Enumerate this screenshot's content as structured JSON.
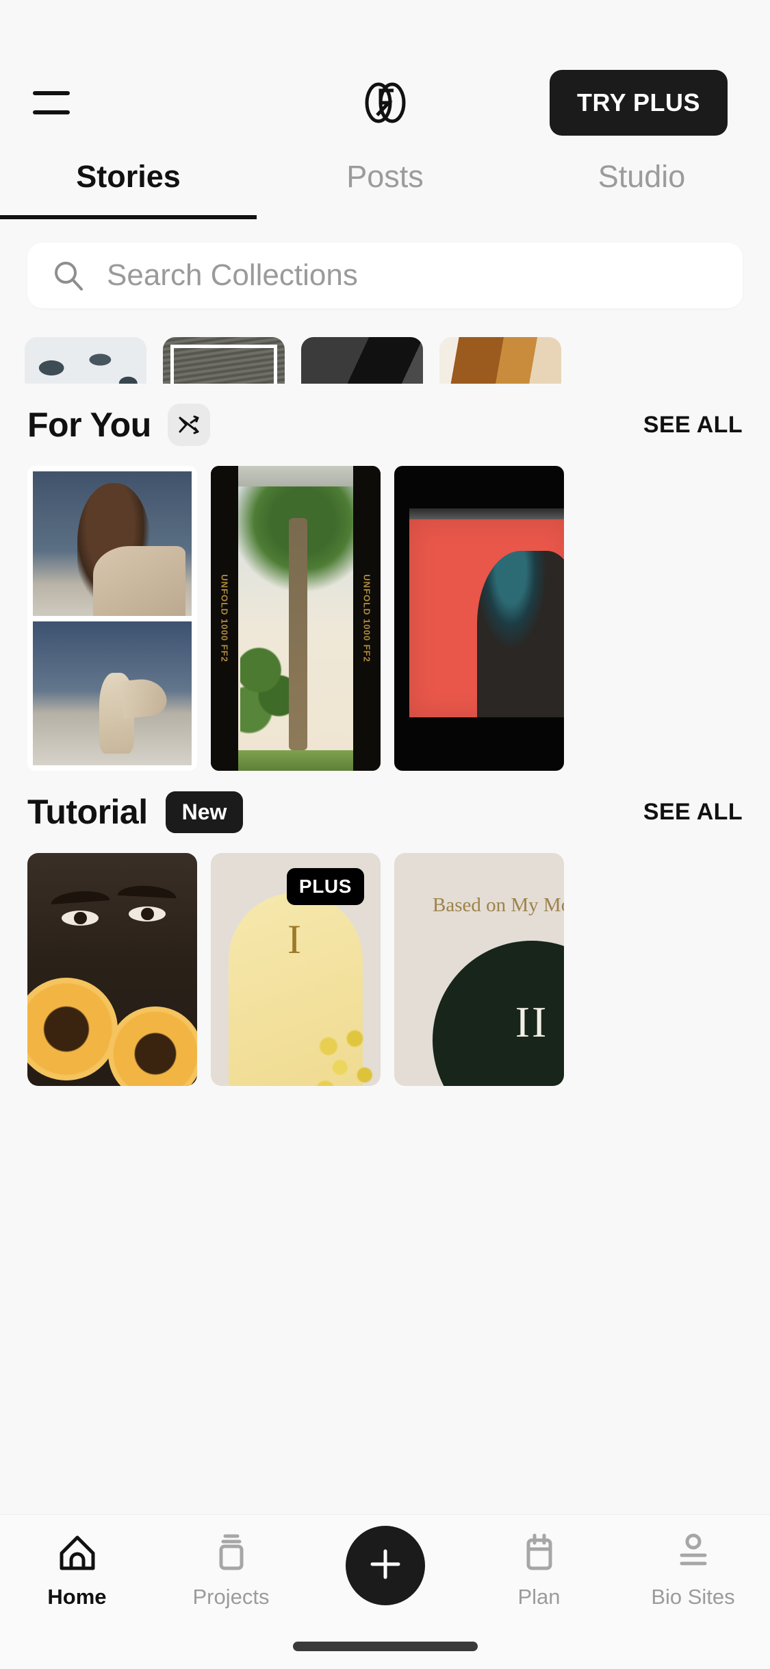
{
  "app": {
    "name": "Unfold",
    "logo_icon": "unfold-logo-icon"
  },
  "header": {
    "menu_icon": "hamburger-menu-icon",
    "cta_label": "TRY PLUS"
  },
  "tabs": [
    {
      "label": "Stories",
      "active": true
    },
    {
      "label": "Posts",
      "active": false
    },
    {
      "label": "Studio",
      "active": false
    }
  ],
  "search": {
    "placeholder": "Search Collections",
    "value": "",
    "icon": "search-icon"
  },
  "collections_strip": {
    "items": [
      {
        "name": "terrazzo-collection"
      },
      {
        "name": "sand-dune-collection"
      },
      {
        "name": "shadow-collection"
      },
      {
        "name": "sunset-gradient-collection"
      }
    ]
  },
  "sections": [
    {
      "id": "for-you",
      "title": "For You",
      "shuffle_icon": "shuffle-icon",
      "see_all_label": "SEE ALL",
      "cards": [
        {
          "name": "portrait-collage-template",
          "badge": null
        },
        {
          "name": "film-strip-beach-template",
          "film_text": "UNFOLD 1000 FF2",
          "badge": null
        },
        {
          "name": "red-poster-template",
          "badge": null
        }
      ]
    },
    {
      "id": "tutorial",
      "title": "Tutorial",
      "badge": "New",
      "see_all_label": "SEE ALL",
      "cards": [
        {
          "name": "sunflower-tutorial-card",
          "badge": null
        },
        {
          "name": "arch-tutorial-card",
          "badge": "PLUS",
          "roman": "I"
        },
        {
          "name": "mood-tutorial-card",
          "badge": null,
          "caption": "Based on My Mood",
          "roman": "II"
        }
      ]
    }
  ],
  "bottom_nav": [
    {
      "label": "Home",
      "icon": "home-icon",
      "active": true
    },
    {
      "label": "Projects",
      "icon": "projects-icon",
      "active": false
    },
    {
      "label": "",
      "icon": "plus-icon",
      "active": false,
      "is_fab": true
    },
    {
      "label": "Plan",
      "icon": "calendar-icon",
      "active": false
    },
    {
      "label": "Bio Sites",
      "icon": "bio-sites-icon",
      "active": false
    }
  ],
  "colors": {
    "background": "#f8f8f8",
    "accent_dark": "#1b1b1b",
    "muted_text": "#9b9b9b",
    "card_red": "#e8574a",
    "card_beige": "#e3ddd6",
    "gold_text": "#9e8249"
  }
}
